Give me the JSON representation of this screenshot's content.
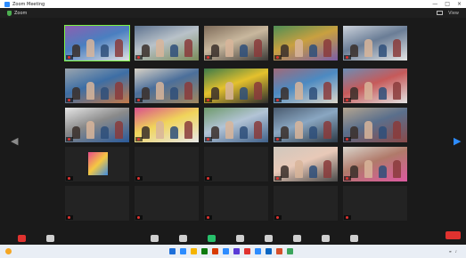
{
  "window": {
    "title": "Zoom Meeting",
    "controls": [
      "—",
      "□",
      "×"
    ]
  },
  "meeting_bar": {
    "title": "Zoom",
    "view_label": "View"
  },
  "gallery": {
    "tiles": [
      {
        "label": "",
        "text": "",
        "type": "video",
        "scene": [
          "#8c5fb0",
          "#4a7fc0",
          "#e2e2e2"
        ]
      },
      {
        "label": "",
        "text": "",
        "type": "video",
        "scene": [
          "#5e7390",
          "#b9c2c9",
          "#7a8b5a"
        ]
      },
      {
        "label": "",
        "text": "",
        "type": "video",
        "scene": [
          "#7f6c5a",
          "#c9b89e",
          "#3d3a37"
        ]
      },
      {
        "label": "",
        "text": "",
        "type": "video",
        "scene": [
          "#4e8e55",
          "#c9a040",
          "#7b5ea7"
        ]
      },
      {
        "label": "",
        "text": "",
        "type": "video",
        "scene": [
          "#cdd3dc",
          "#6a7d96",
          "#e6e6e6"
        ]
      },
      {
        "label": "",
        "text": "",
        "type": "video",
        "scene": [
          "#9ba5ae",
          "#3d6ea5",
          "#c47a4a"
        ]
      },
      {
        "label": "",
        "text": "",
        "type": "video",
        "scene": [
          "#d8d2c6",
          "#4b6f9b",
          "#a3865e"
        ]
      },
      {
        "label": "",
        "text": "",
        "type": "video",
        "scene": [
          "#3b7a4a",
          "#e4c12d",
          "#2e2e2e"
        ]
      },
      {
        "label": "",
        "text": "",
        "type": "video",
        "scene": [
          "#a06a7a",
          "#4c8ac2",
          "#dcd6c9"
        ]
      },
      {
        "label": "",
        "text": "",
        "type": "video",
        "scene": [
          "#6c8db5",
          "#c65a5a",
          "#e3e3e3"
        ]
      },
      {
        "label": "",
        "text": "",
        "type": "video",
        "scene": [
          "#e6e6e6",
          "#8a8a8a",
          "#2a5a9a"
        ]
      },
      {
        "label": "",
        "text": "",
        "type": "video",
        "scene": [
          "#d94f8c",
          "#f0d45a",
          "#e8e8e8"
        ]
      },
      {
        "label": "",
        "text": "",
        "type": "video",
        "scene": [
          "#6e9a6a",
          "#b3c4d6",
          "#40618a"
        ]
      },
      {
        "label": "",
        "text": "",
        "type": "video",
        "scene": [
          "#4a5b6f",
          "#8aa7c2",
          "#2e3a47"
        ]
      },
      {
        "label": "",
        "text": "",
        "type": "video",
        "scene": [
          "#b5a590",
          "#5a6f8c",
          "#8a4a4a"
        ]
      },
      {
        "label": "",
        "text": "",
        "type": "avatar"
      },
      {
        "label": "",
        "text": "",
        "type": "text"
      },
      {
        "label": "",
        "text": "",
        "type": "text"
      },
      {
        "label": "",
        "text": "",
        "type": "video",
        "scene": [
          "#cfc8bd",
          "#e8c9b8",
          "#4a4a4a"
        ]
      },
      {
        "label": "",
        "text": "",
        "type": "video",
        "scene": [
          "#d9d5cc",
          "#b07a6a",
          "#dd5aa0"
        ]
      },
      {
        "label": "",
        "text": "",
        "type": "text"
      },
      {
        "label": "",
        "text": "",
        "type": "text"
      },
      {
        "label": "",
        "text": "",
        "type": "text"
      },
      {
        "label": "",
        "text": "",
        "type": "text"
      },
      {
        "label": "",
        "text": "",
        "type": "text"
      }
    ]
  },
  "toolbar": {
    "left": [
      {
        "name": "audio",
        "label": "",
        "color": "#e0322f"
      },
      {
        "name": "video",
        "label": "",
        "color": "#cfcfcf"
      }
    ],
    "center": [
      {
        "name": "participants",
        "label": "",
        "color": "#cfcfcf"
      },
      {
        "name": "chat",
        "label": "",
        "color": "#cfcfcf"
      },
      {
        "name": "share-screen",
        "label": "",
        "color": "#27c06b"
      },
      {
        "name": "record",
        "label": "",
        "color": "#cfcfcf"
      },
      {
        "name": "reactions",
        "label": "",
        "color": "#cfcfcf"
      },
      {
        "name": "apps",
        "label": "",
        "color": "#cfcfcf"
      },
      {
        "name": "whiteboards",
        "label": "",
        "color": "#cfcfcf"
      },
      {
        "name": "more",
        "label": "",
        "color": "#cfcfcf"
      }
    ],
    "end_label": ""
  },
  "taskbar": {
    "weather": {
      "line1": "",
      "line2": ""
    },
    "apps": [
      "#1e6fd9",
      "#2d8cff",
      "#f5b400",
      "#0f7b0f",
      "#d83b01",
      "#2d8cff",
      "#5a3bd6",
      "#e0322f",
      "#2d8cff",
      "#0a66c2",
      "#d64f2a",
      "#3ba55c"
    ],
    "clock": {
      "time": "",
      "date": ""
    }
  },
  "colors": {
    "accent": "#2d8cff",
    "speaker_border": "#7cf542",
    "end": "#e0322f",
    "background": "#1a1a1a"
  }
}
